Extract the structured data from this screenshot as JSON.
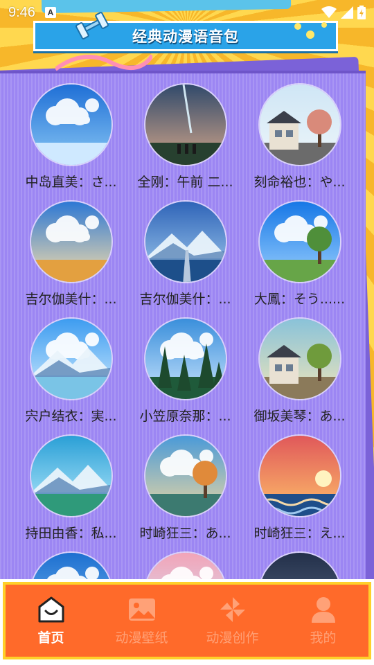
{
  "status_bar": {
    "time": "9:46",
    "notification_badge": "A",
    "icons": [
      "wifi-icon",
      "signal-icon",
      "battery-icon"
    ]
  },
  "header": {
    "title": "经典动漫语音包"
  },
  "grid": {
    "items": [
      {
        "label": "中岛直美：さ...",
        "scene": "clouds"
      },
      {
        "label": "全刚：午前 二...",
        "scene": "comet"
      },
      {
        "label": "刻命裕也：や...",
        "scene": "street"
      },
      {
        "label": "吉尔伽美什：...",
        "scene": "field"
      },
      {
        "label": "吉尔伽美什：...",
        "scene": "pier"
      },
      {
        "label": "大鳳：そう......",
        "scene": "city-sky"
      },
      {
        "label": "宍户结衣：実...",
        "scene": "mountain-lake"
      },
      {
        "label": "小笠原奈那：...",
        "scene": "forest"
      },
      {
        "label": "御坂美琴：あ...",
        "scene": "garden"
      },
      {
        "label": "持田由香：私...",
        "scene": "valley"
      },
      {
        "label": "时崎狂三：あ...",
        "scene": "autumn"
      },
      {
        "label": "时崎狂三：え...",
        "scene": "sunset"
      },
      {
        "label": "",
        "scene": "sky-partial"
      },
      {
        "label": "",
        "scene": "pink-partial"
      },
      {
        "label": "",
        "scene": "night-partial"
      }
    ]
  },
  "nav": {
    "items": [
      {
        "label": "首页",
        "icon": "home-icon",
        "active": true
      },
      {
        "label": "动漫壁纸",
        "icon": "image-icon",
        "active": false
      },
      {
        "label": "动漫创作",
        "icon": "pinwheel-icon",
        "active": false
      },
      {
        "label": "我的",
        "icon": "user-icon",
        "active": false
      }
    ]
  },
  "colors": {
    "card": "#9c86f3",
    "nav_bg": "#ff6a2a",
    "nav_border": "#ffd02a",
    "banner": "#2aa3e8"
  }
}
